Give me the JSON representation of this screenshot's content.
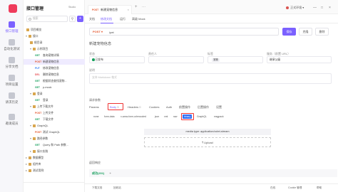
{
  "rail": {
    "items": [
      {
        "label": "接口管理",
        "active": true
      },
      {
        "label": "自动化测试"
      },
      {
        "label": "分享文档"
      },
      {
        "label": "项目设置"
      },
      {
        "label": "请求历史"
      },
      {
        "label": "邀请成员"
      }
    ]
  },
  "sidebar": {
    "project_title": "接口管理",
    "project_tag": "Studio",
    "search_placeholder": "搜索",
    "add_label": "+",
    "filter_label": "⚲",
    "tree": [
      {
        "label": "项目概览",
        "icon": "home"
      },
      {
        "label": "接口",
        "arrow": "▾",
        "icon": "folder"
      },
      {
        "label": "根目录",
        "icon": "folder"
      },
      {
        "label": "示例项目",
        "arrow": "▾",
        "icon": "folder"
      },
      {
        "label": "查询宠物详情",
        "method": "GET"
      },
      {
        "label": "新建宠物信息",
        "method": "POST",
        "selected": true
      },
      {
        "label": "修改宠物信息",
        "method": "PUT"
      },
      {
        "label": "删除宠物信息",
        "method": "DEL"
      },
      {
        "label": "根据状态查找宠物...",
        "method": "GET"
      },
      {
        "label": "p-mock",
        "method": "GET"
      },
      {
        "label": "登录",
        "arrow": "▾",
        "icon": "folder"
      },
      {
        "label": "登录",
        "method": "GET"
      },
      {
        "label": "上传下载文件",
        "arrow": "▾",
        "icon": "folder"
      },
      {
        "label": "上传文件",
        "method": "POST"
      },
      {
        "label": "下载文件",
        "method": "GET"
      },
      {
        "label": "GraphQL",
        "arrow": "▾",
        "icon": "folder"
      },
      {
        "label": "测试 GraphQL",
        "method": "POST"
      },
      {
        "label": "路径参数",
        "arrow": "▾",
        "icon": "folder"
      },
      {
        "label": "Query 和 Path 参数...",
        "method": "GET"
      },
      {
        "label": "接口实践",
        "arrow": "▸",
        "icon": "folder"
      },
      {
        "label": "数据模型",
        "arrow": "▸",
        "icon": "folder"
      },
      {
        "label": "组件库",
        "arrow": "▸",
        "icon": "folder"
      },
      {
        "label": "测试用例",
        "arrow": "▸",
        "icon": "folder"
      }
    ]
  },
  "header": {
    "tabs": [
      {
        "method": "POST",
        "label": "新建宠物信息",
        "close": "×"
      }
    ],
    "add_tab": "+",
    "more": "···",
    "env_label": "正式环境",
    "env_arrow": "▾",
    "win_controls": [
      "—",
      "□",
      "×"
    ]
  },
  "subtabs": [
    {
      "label": "文档"
    },
    {
      "label": "修改文档",
      "active": true
    },
    {
      "label": "运行"
    },
    {
      "label": "高级 Mock"
    }
  ],
  "urlbar": {
    "method": "POST",
    "arrow": "▾",
    "path": "/pet"
  },
  "actions": {
    "save": "保存",
    "clone": "克隆",
    "delete": "删除"
  },
  "api_name": "新建宠物信息",
  "fields": {
    "status_label": "状态",
    "status_value": "已发布",
    "owner_label": "责任人",
    "owner_value": "",
    "tags_label": "标签",
    "tags_value": "宠物",
    "service_label": "服务（前置 URL）",
    "service_value": "继承父级"
  },
  "description": {
    "label": "说明",
    "placeholder": "支持 Markdown 格式"
  },
  "params": {
    "label": "请求参数",
    "tabs": [
      {
        "label": "Params",
        "count": ""
      },
      {
        "label": "Body",
        "count": "3",
        "active": true
      },
      {
        "label": "Headers",
        "count": "0"
      },
      {
        "label": "Cookies",
        "count": ""
      },
      {
        "label": "Auth",
        "count": ""
      },
      {
        "label": "前置操作",
        "count": ""
      },
      {
        "label": "后置操作",
        "count": ""
      },
      {
        "label": "设置",
        "count": ""
      }
    ],
    "body_types": [
      {
        "label": "none"
      },
      {
        "label": "form-data"
      },
      {
        "label": "x-www-form-urlencoded"
      },
      {
        "label": "json"
      },
      {
        "label": "xml"
      },
      {
        "label": "raw"
      },
      {
        "label": "binary",
        "active": true
      },
      {
        "label": "GraphQL"
      },
      {
        "label": "msgpack"
      }
    ],
    "media_type": "media type: application/octet-stream",
    "upload": "⤒ Upload"
  },
  "response": {
    "label": "返回响应",
    "ok_code": "成功(201)",
    "add": "+"
  },
  "bottom_bar": {
    "items": [
      "下载文档",
      "回收站",
      "在线",
      "Cookie 管理",
      "帮助"
    ]
  },
  "colors": {
    "accent": "#7b61ff",
    "post": "#e4572e",
    "get": "#17a05d",
    "binary_active": "#2f6df6",
    "highlight_box": "#ee3333"
  }
}
